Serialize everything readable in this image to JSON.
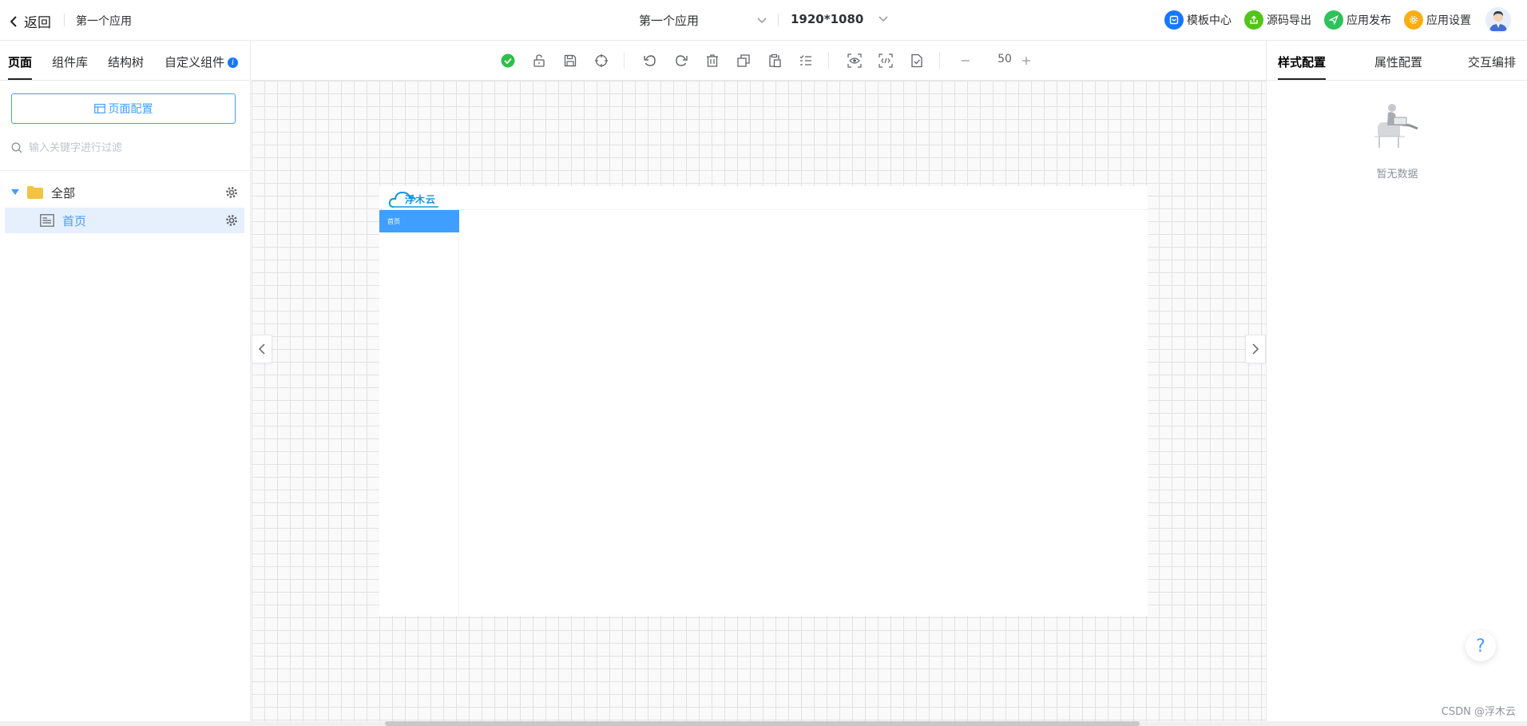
{
  "topbar": {
    "back_label": "返回",
    "app_name": "第一个应用",
    "app_select": "第一个应用",
    "resolution_select": "1920*1080",
    "links": [
      {
        "label": "模板中心",
        "icon": "template-icon",
        "color": "#1677ff"
      },
      {
        "label": "源码导出",
        "icon": "export-icon",
        "color": "#52c41a"
      },
      {
        "label": "应用发布",
        "icon": "publish-icon",
        "color": "#2fc25b"
      },
      {
        "label": "应用设置",
        "icon": "settings-icon",
        "color": "#faad14"
      }
    ]
  },
  "left": {
    "tabs": [
      "页面",
      "组件库",
      "结构树",
      "自定义组件"
    ],
    "active_tab": "页面",
    "page_config_label": "页面配置",
    "filter_placeholder": "输入关键字进行过滤",
    "tree": [
      {
        "label": "全部",
        "icon": "folder-icon",
        "expanded": true
      },
      {
        "label": "首页",
        "icon": "page-icon",
        "selected": true
      }
    ]
  },
  "toolbar": {
    "icons": [
      "check-circle-icon",
      "unlock-icon",
      "save-icon",
      "crosshair-icon",
      "undo-icon",
      "redo-icon",
      "delete-icon",
      "copy-icon",
      "paste-icon",
      "list-icon",
      "preview-icon",
      "code-icon",
      "validate-icon"
    ],
    "zoom_value": "50"
  },
  "canvas": {
    "logo_text": "浮木云",
    "menu_item": "首页"
  },
  "right": {
    "tabs": [
      "样式配置",
      "属性配置",
      "交互编排"
    ],
    "active_tab": "样式配置",
    "empty_text": "暂无数据"
  },
  "help_label": "?",
  "watermark": "CSDN @浮木云",
  "colors": {
    "primary": "#409eff",
    "selected_row_bg": "#e6f0fd",
    "grid_line": "#e2e2e2"
  }
}
